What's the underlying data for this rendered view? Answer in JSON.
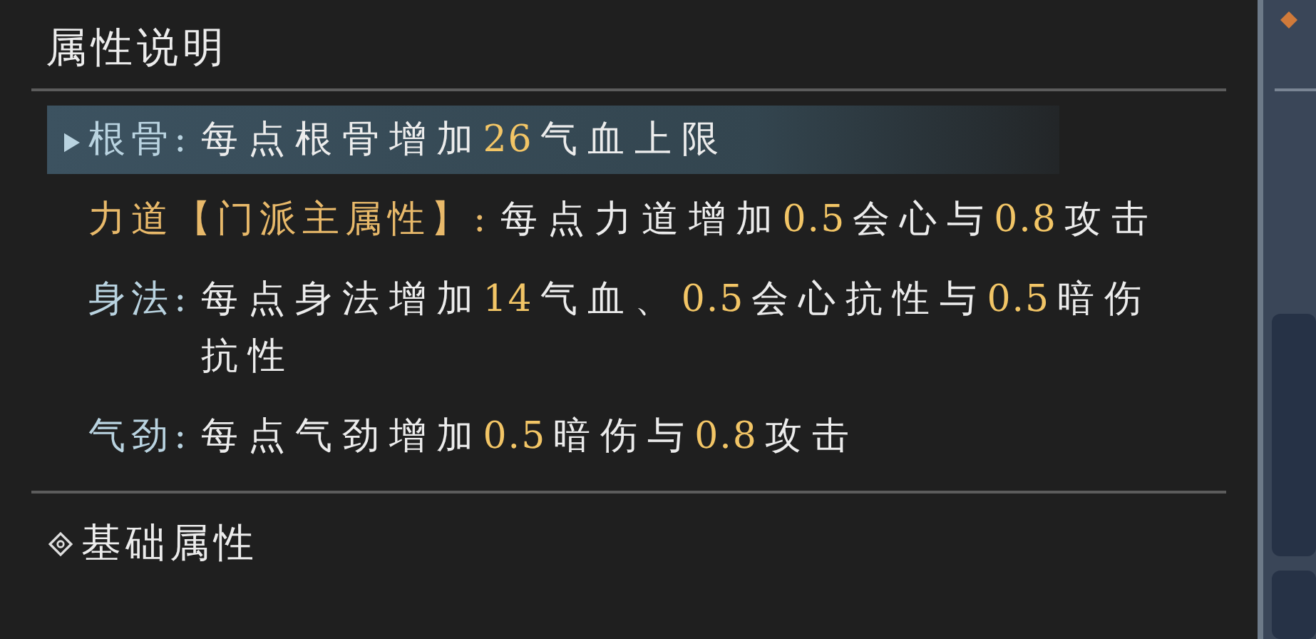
{
  "panel": {
    "title": "属性说明",
    "attributes": [
      {
        "label": "根骨:",
        "kind": "normal",
        "selected": true,
        "parts": [
          {
            "text": "每点根骨增加",
            "highlight": false
          },
          {
            "text": "26",
            "highlight": true
          },
          {
            "text": "气血上限",
            "highlight": false
          }
        ]
      },
      {
        "label": "力道【门派主属性】:",
        "kind": "main",
        "selected": false,
        "parts": [
          {
            "text": "每点力道增加",
            "highlight": false
          },
          {
            "text": "0.5",
            "highlight": true
          },
          {
            "text": "会心与",
            "highlight": false
          },
          {
            "text": "0.8",
            "highlight": true
          },
          {
            "text": "攻击",
            "highlight": false
          }
        ]
      },
      {
        "label": "身法:",
        "kind": "normal",
        "selected": false,
        "parts": [
          {
            "text": "每点身法增加",
            "highlight": false
          },
          {
            "text": "14",
            "highlight": true
          },
          {
            "text": "气血、",
            "highlight": false
          },
          {
            "text": "0.5",
            "highlight": true
          },
          {
            "text": "会心抗性与",
            "highlight": false
          },
          {
            "text": "0.5",
            "highlight": true
          },
          {
            "text": "暗伤抗性",
            "highlight": false
          }
        ]
      },
      {
        "label": "气劲:",
        "kind": "normal",
        "selected": false,
        "parts": [
          {
            "text": "每点气劲增加",
            "highlight": false
          },
          {
            "text": "0.5",
            "highlight": true
          },
          {
            "text": "暗伤与",
            "highlight": false
          },
          {
            "text": "0.8",
            "highlight": true
          },
          {
            "text": "攻击",
            "highlight": false
          }
        ]
      }
    ],
    "section": {
      "title": "基础属性"
    }
  }
}
